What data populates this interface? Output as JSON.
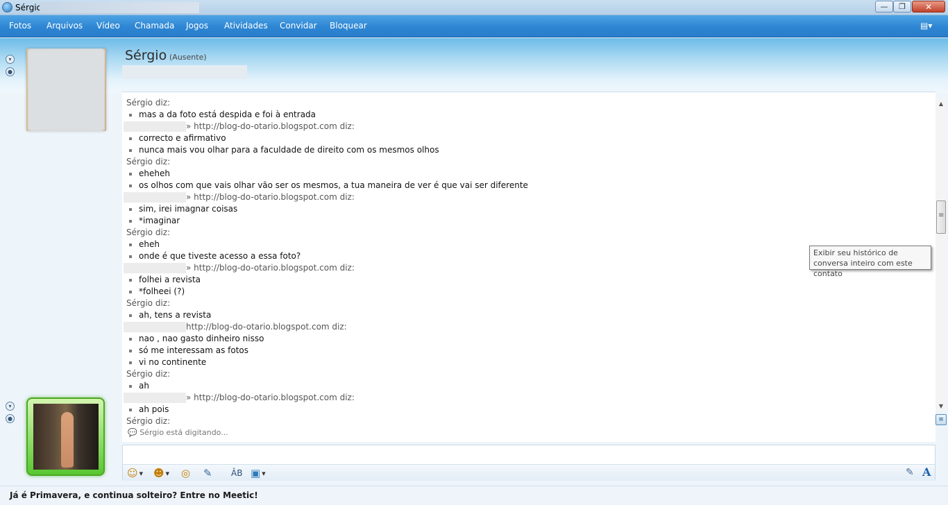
{
  "window": {
    "title": "Sérgio",
    "controls": {
      "minimize": "—",
      "maximize": "❐",
      "close": "✕"
    }
  },
  "menu": {
    "items": [
      "Fotos",
      "Arquivos",
      "Vídeo",
      "Chamada",
      "Jogos",
      "Atividades",
      "Convidar",
      "Bloquear"
    ],
    "options_icon": "options-menu-icon"
  },
  "contact": {
    "name": "Sérgio",
    "status": "(Ausente)"
  },
  "conversation": [
    {
      "type": "sender",
      "text": "Sérgio diz:"
    },
    {
      "type": "msg",
      "text": "mas a da foto está despida e foi à entrada"
    },
    {
      "type": "me",
      "text": "» http://blog-do-otario.blogspot.com diz:"
    },
    {
      "type": "msg",
      "text": "correcto e afirmativo"
    },
    {
      "type": "msg",
      "text": "nunca mais vou olhar para a faculdade de direito com os mesmos olhos"
    },
    {
      "type": "sender",
      "text": "Sérgio diz:"
    },
    {
      "type": "msg",
      "text": "eheheh"
    },
    {
      "type": "msg",
      "text": "os olhos com que vais olhar vão ser os mesmos, a tua maneira de ver é que vai ser diferente"
    },
    {
      "type": "me",
      "text": "» http://blog-do-otario.blogspot.com diz:"
    },
    {
      "type": "msg",
      "text": "sim, irei imagnar coisas"
    },
    {
      "type": "msg",
      "text": "*imaginar"
    },
    {
      "type": "sender",
      "text": "Sérgio diz:"
    },
    {
      "type": "msg",
      "text": "eheh"
    },
    {
      "type": "msg",
      "text": "onde é que tiveste acesso a essa foto?"
    },
    {
      "type": "me",
      "text": "» http://blog-do-otario.blogspot.com diz:"
    },
    {
      "type": "msg",
      "text": "folhei a revista"
    },
    {
      "type": "msg",
      "text": "*folheei (?)"
    },
    {
      "type": "sender",
      "text": "Sérgio diz:"
    },
    {
      "type": "msg",
      "text": "ah, tens a revista"
    },
    {
      "type": "me",
      "text": "http://blog-do-otario.blogspot.com diz:"
    },
    {
      "type": "msg",
      "text": "nao , nao gasto dinheiro nisso"
    },
    {
      "type": "msg",
      "text": "só me interessam as fotos"
    },
    {
      "type": "msg",
      "text": "vi no continente"
    },
    {
      "type": "sender",
      "text": "Sérgio diz:"
    },
    {
      "type": "msg",
      "text": "ah"
    },
    {
      "type": "me",
      "text": "» http://blog-do-otario.blogspot.com diz:"
    },
    {
      "type": "msg",
      "text": "ah pois"
    },
    {
      "type": "sender",
      "text": "Sérgio diz:"
    }
  ],
  "typing_indicator": "Sérgio está digitando...",
  "tooltip": "Exibir seu histórico de conversa inteiro com este contato",
  "input": {
    "value": "",
    "placeholder": ""
  },
  "toolbar": {
    "emoticon": "☺",
    "wink": "☻",
    "nudge": "◎",
    "voice_clip": "✎",
    "spellcheck": "ÂB",
    "background": "▣"
  },
  "ad": {
    "text": "Já é Primavera, e continua solteiro? Entre no Meetic!"
  },
  "colors": {
    "menubar": "#2d86d3",
    "accent_green": "#58c730",
    "link_blue": "#1d5fa8"
  }
}
